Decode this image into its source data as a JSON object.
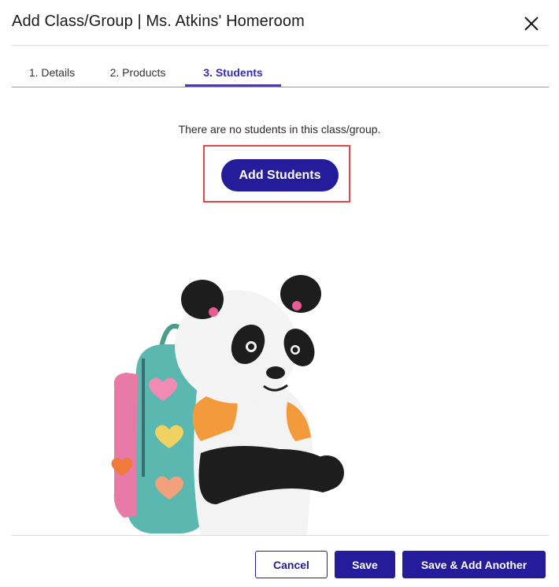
{
  "dialog": {
    "title": "Add Class/Group | Ms. Atkins' Homeroom",
    "close_icon": "close-icon"
  },
  "tabs": [
    {
      "label": "1. Details",
      "active": false
    },
    {
      "label": "2. Products",
      "active": false
    },
    {
      "label": "3. Students",
      "active": true
    }
  ],
  "students": {
    "empty_message": "There are no students in this class/group.",
    "add_button_label": "Add Students"
  },
  "illustration": {
    "subject": "panda-with-backpack"
  },
  "footer": {
    "cancel_label": "Cancel",
    "save_label": "Save",
    "save_add_label": "Save & Add Another"
  },
  "colors": {
    "primary": "#241c9a",
    "tab_active_text": "#3b2ab8",
    "tab_underline": "#5a2be0",
    "highlight": "#e0484b"
  }
}
